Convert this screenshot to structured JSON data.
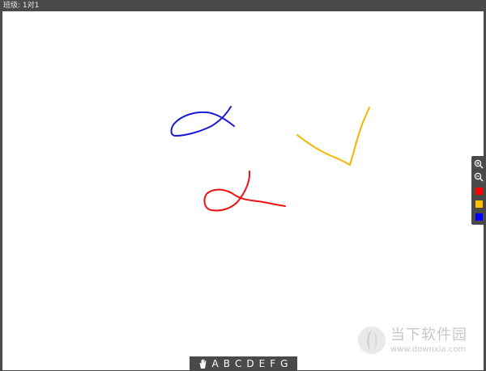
{
  "window": {
    "title": "班级: 1对1"
  },
  "canvas": {
    "strokes": [
      {
        "name": "blue-stroke",
        "color": "#1a1ad6"
      },
      {
        "name": "yellow-stroke",
        "color": "#f5b400"
      },
      {
        "name": "red-stroke",
        "color": "#ee1111"
      }
    ]
  },
  "side_toolbar": {
    "zoom_in_icon": "zoom-in-icon",
    "zoom_out_icon": "zoom-out-icon",
    "colors": [
      {
        "name": "red",
        "hex": "#ff0000"
      },
      {
        "name": "yellow",
        "hex": "#ffc000"
      },
      {
        "name": "blue",
        "hex": "#0000ff"
      }
    ]
  },
  "bottom_toolbar": {
    "hand_icon": "hand-icon",
    "pages": [
      "A",
      "B",
      "C",
      "D",
      "E",
      "F",
      "G"
    ]
  },
  "watermark": {
    "name": "当下软件园",
    "url": "www.downxia.com"
  }
}
